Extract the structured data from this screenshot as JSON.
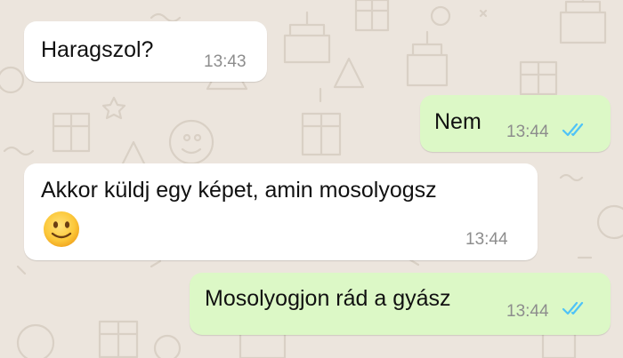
{
  "chat": {
    "messages": [
      {
        "direction": "incoming",
        "text": "Haragszol?",
        "time": "13:43"
      },
      {
        "direction": "outgoing",
        "text": "Nem",
        "time": "13:44",
        "status": "read"
      },
      {
        "direction": "incoming",
        "text": "Akkor küldj egy képet, amin mosolyogsz",
        "emoji": "slightly-smiling-face-icon",
        "time": "13:44"
      },
      {
        "direction": "outgoing",
        "text": "Mosolyogjon rád a gyász",
        "time": "13:44",
        "status": "read"
      }
    ]
  },
  "colors": {
    "wallpaper": "#ece5dd",
    "incoming_bubble": "#ffffff",
    "outgoing_bubble": "#dcf8c6",
    "read_ticks": "#4fc3f7",
    "timestamp": "#8d8d8d"
  }
}
